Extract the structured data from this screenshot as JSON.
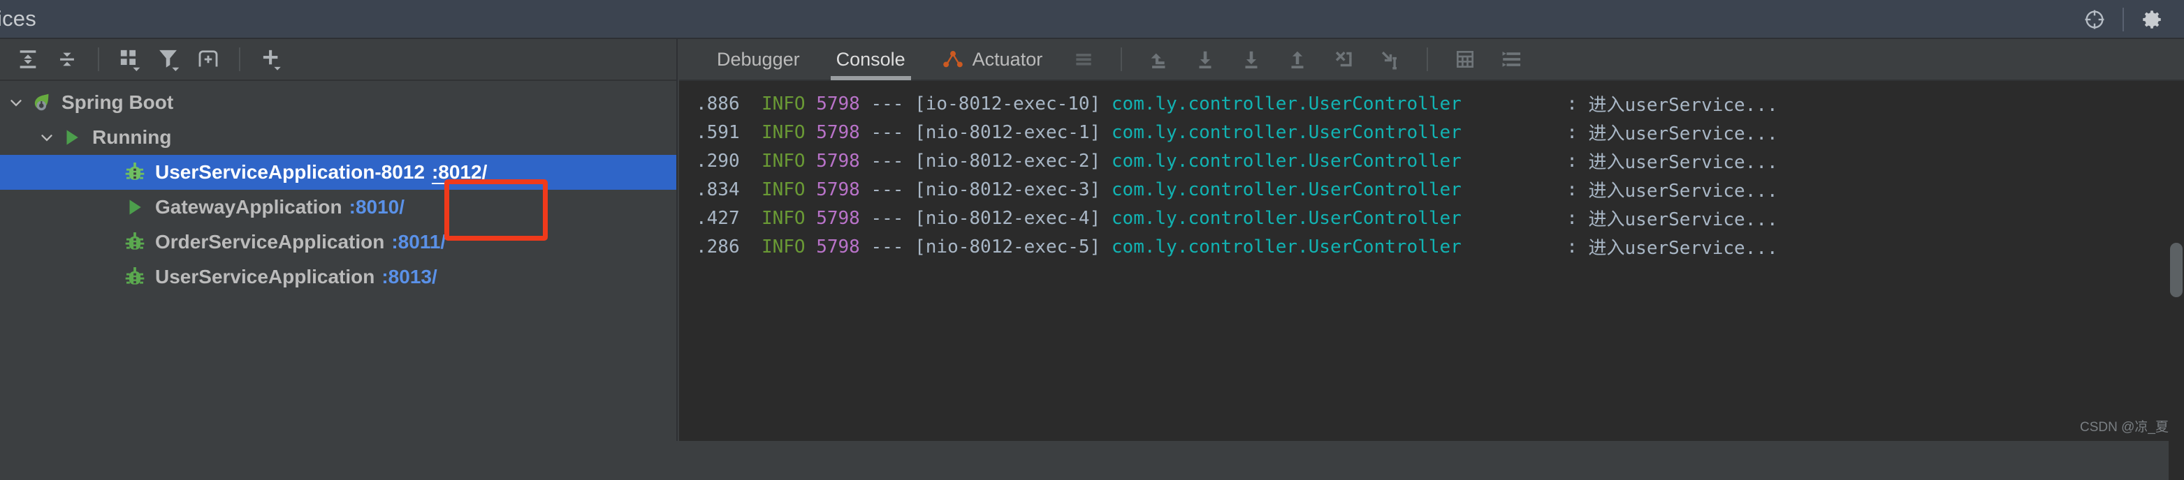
{
  "window": {
    "title": "ices",
    "right_icons": [
      {
        "name": "locate-icon",
        "label": "Locate"
      },
      {
        "name": "settings-gear-icon",
        "label": "Settings"
      }
    ]
  },
  "sidebar": {
    "toolbar": [
      {
        "name": "expand-all-icon",
        "label": "Expand All"
      },
      {
        "name": "collapse-all-icon",
        "label": "Collapse All"
      },
      {
        "name": "separator",
        "label": ""
      },
      {
        "name": "group-by-icon",
        "label": "Group By"
      },
      {
        "name": "filter-icon",
        "label": "Filter"
      },
      {
        "name": "add-tab-icon",
        "label": "Add Tab"
      },
      {
        "name": "separator",
        "label": ""
      },
      {
        "name": "add-service-icon",
        "label": "Add Service"
      }
    ],
    "tree": [
      {
        "label": "Spring Boot",
        "port": "",
        "icon": "spring-boot-icon",
        "twisty": "chevron-down",
        "indent": 1,
        "selected": false
      },
      {
        "label": "Running",
        "port": "",
        "icon": "run-triangle-icon",
        "twisty": "chevron-down",
        "indent": 2,
        "selected": false
      },
      {
        "label": "UserServiceApplication-8012",
        "port": ":8012/",
        "icon": "debug-bug-icon",
        "twisty": "",
        "indent": 3,
        "selected": true
      },
      {
        "label": "GatewayApplication",
        "port": ":8010/",
        "icon": "run-triangle-icon",
        "twisty": "",
        "indent": 3,
        "selected": false
      },
      {
        "label": "OrderServiceApplication",
        "port": ":8011/",
        "icon": "debug-bug-icon",
        "twisty": "",
        "indent": 3,
        "selected": false
      },
      {
        "label": "UserServiceApplication",
        "port": ":8013/",
        "icon": "debug-bug-icon",
        "twisty": "",
        "indent": 3,
        "selected": false
      }
    ]
  },
  "annotation": {
    "type": "red-rectangle",
    "color": "#f03a1b",
    "target_text": ":8012/"
  },
  "console": {
    "tabs": [
      {
        "label": "Debugger",
        "icon": "",
        "active": false
      },
      {
        "label": "Console",
        "icon": "",
        "active": true
      },
      {
        "label": "Actuator",
        "icon": "actuator-graph-icon",
        "active": false
      }
    ],
    "toolbar": [
      {
        "name": "soft-wrap-icon",
        "label": "Soft-Wrap"
      },
      {
        "name": "show-execution-point-icon",
        "label": "Show Execution Point"
      },
      {
        "name": "step-over-icon",
        "label": "Step Over"
      },
      {
        "name": "step-into-icon",
        "label": "Step Into"
      },
      {
        "name": "step-out-icon",
        "label": "Step Out"
      },
      {
        "name": "force-step-into-icon",
        "label": "Force Step Into"
      },
      {
        "name": "run-to-cursor-icon",
        "label": "Run to Cursor"
      },
      {
        "name": "evaluate-expression-icon",
        "label": "Evaluate Expression"
      },
      {
        "name": "settings-list-icon",
        "label": "Layout Settings"
      }
    ],
    "log_lines": [
      {
        "time": ".886",
        "level": "INFO",
        "pid": "5798",
        "dashes": "---",
        "thread": "[io-8012-exec-10]",
        "logger": "com.ly.controller.UserController",
        "sep": ":",
        "message": "进入userService..."
      },
      {
        "time": ".591",
        "level": "INFO",
        "pid": "5798",
        "dashes": "---",
        "thread": "[nio-8012-exec-1]",
        "logger": "com.ly.controller.UserController",
        "sep": ":",
        "message": "进入userService..."
      },
      {
        "time": ".290",
        "level": "INFO",
        "pid": "5798",
        "dashes": "---",
        "thread": "[nio-8012-exec-2]",
        "logger": "com.ly.controller.UserController",
        "sep": ":",
        "message": "进入userService..."
      },
      {
        "time": ".834",
        "level": "INFO",
        "pid": "5798",
        "dashes": "---",
        "thread": "[nio-8012-exec-3]",
        "logger": "com.ly.controller.UserController",
        "sep": ":",
        "message": "进入userService..."
      },
      {
        "time": ".427",
        "level": "INFO",
        "pid": "5798",
        "dashes": "---",
        "thread": "[nio-8012-exec-4]",
        "logger": "com.ly.controller.UserController",
        "sep": ":",
        "message": "进入userService..."
      },
      {
        "time": ".286",
        "level": "INFO",
        "pid": "5798",
        "dashes": "---",
        "thread": "[nio-8012-exec-5]",
        "logger": "com.ly.controller.UserController",
        "sep": ":",
        "message": "进入userService..."
      }
    ]
  },
  "watermark": "CSDN @凉_夏",
  "colors": {
    "selection_blue": "#2f65c8",
    "link_blue": "#5a91e8",
    "log_level_green": "#6a9a35",
    "log_pid_purple": "#b973c9",
    "log_logger_cyan": "#12b3b3",
    "annotation_red": "#f03a1b",
    "panel_bg": "#3c3f41",
    "console_bg": "#2b2b2b"
  }
}
